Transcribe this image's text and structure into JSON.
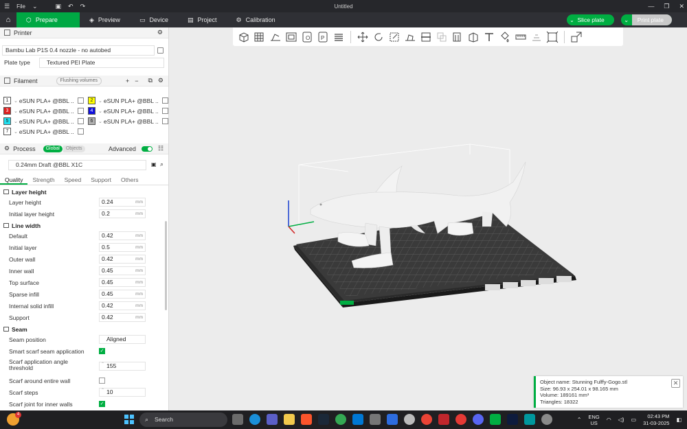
{
  "window": {
    "menu": "File",
    "title": "Untitled"
  },
  "nav": {
    "tabs": [
      "Prepare",
      "Preview",
      "Device",
      "Project",
      "Calibration"
    ],
    "slice_label": "Slice plate",
    "print_label": "Print plate"
  },
  "printer": {
    "section": "Printer",
    "name": "Bambu Lab P1S 0.4 nozzle - no autobed",
    "plate_type_label": "Plate type",
    "plate_type": "Textured PEI Plate"
  },
  "filament": {
    "section": "Filament",
    "flushing": "Flushing volumes",
    "items": [
      {
        "num": "1",
        "name": "eSUN PLA+ @BBL ...",
        "color": "#ffffff"
      },
      {
        "num": "2",
        "name": "eSUN PLA+ @BBL ...",
        "color": "#ffff00"
      },
      {
        "num": "3",
        "name": "eSUN PLA+ @BBL ...",
        "color": "#e02020"
      },
      {
        "num": "4",
        "name": "eSUN PLA+ @BBL ...",
        "color": "#1010e0"
      },
      {
        "num": "5",
        "name": "eSUN PLA+ @BBL ...",
        "color": "#20e0f0"
      },
      {
        "num": "6",
        "name": "eSUN PLA+ @BBL ...",
        "color": "#b0b0b0"
      },
      {
        "num": "7",
        "name": "eSUN PLA+ @BBL ...",
        "color": "#ffffff"
      }
    ]
  },
  "process": {
    "section": "Process",
    "global": "Global",
    "objects": "Objects",
    "advanced": "Advanced",
    "profile": "0.24mm Draft @BBL X1C",
    "tabs": [
      "Quality",
      "Strength",
      "Speed",
      "Support",
      "Others"
    ]
  },
  "settings": {
    "layer_height": {
      "title": "Layer height",
      "rows": [
        {
          "label": "Layer height",
          "value": "0.24",
          "unit": "mm"
        },
        {
          "label": "Initial layer height",
          "value": "0.2",
          "unit": "mm"
        }
      ]
    },
    "line_width": {
      "title": "Line width",
      "rows": [
        {
          "label": "Default",
          "value": "0.42",
          "unit": "mm"
        },
        {
          "label": "Initial layer",
          "value": "0.5",
          "unit": "mm"
        },
        {
          "label": "Outer wall",
          "value": "0.42",
          "unit": "mm"
        },
        {
          "label": "Inner wall",
          "value": "0.45",
          "unit": "mm"
        },
        {
          "label": "Top surface",
          "value": "0.45",
          "unit": "mm"
        },
        {
          "label": "Sparse infill",
          "value": "0.45",
          "unit": "mm"
        },
        {
          "label": "Internal solid infill",
          "value": "0.42",
          "unit": "mm"
        },
        {
          "label": "Support",
          "value": "0.42",
          "unit": "mm"
        }
      ]
    },
    "seam": {
      "title": "Seam",
      "position_label": "Seam position",
      "position_value": "Aligned",
      "smart_scarf_label": "Smart scarf seam application",
      "scarf_angle_label": "Scarf application angle threshold",
      "scarf_angle_value": "155",
      "scarf_entire_label": "Scarf around entire wall",
      "scarf_steps_label": "Scarf steps",
      "scarf_steps_value": "10",
      "scarf_inner_label": "Scarf joint for inner walls"
    }
  },
  "notification": {
    "object_name": "Object name: Stunning Fulffy-Gogo.stl",
    "size": "Size: 96.93 x 254.01 x 98.165 mm",
    "volume": "Volume: 189161 mm³",
    "triangles": "Triangles: 18322"
  },
  "taskbar": {
    "badge": "4",
    "search": "Search",
    "lang1": "ENG",
    "lang2": "US",
    "time": "02:43 PM",
    "date": "31-03-2025"
  },
  "colors": {
    "accent": "#00ae42"
  }
}
